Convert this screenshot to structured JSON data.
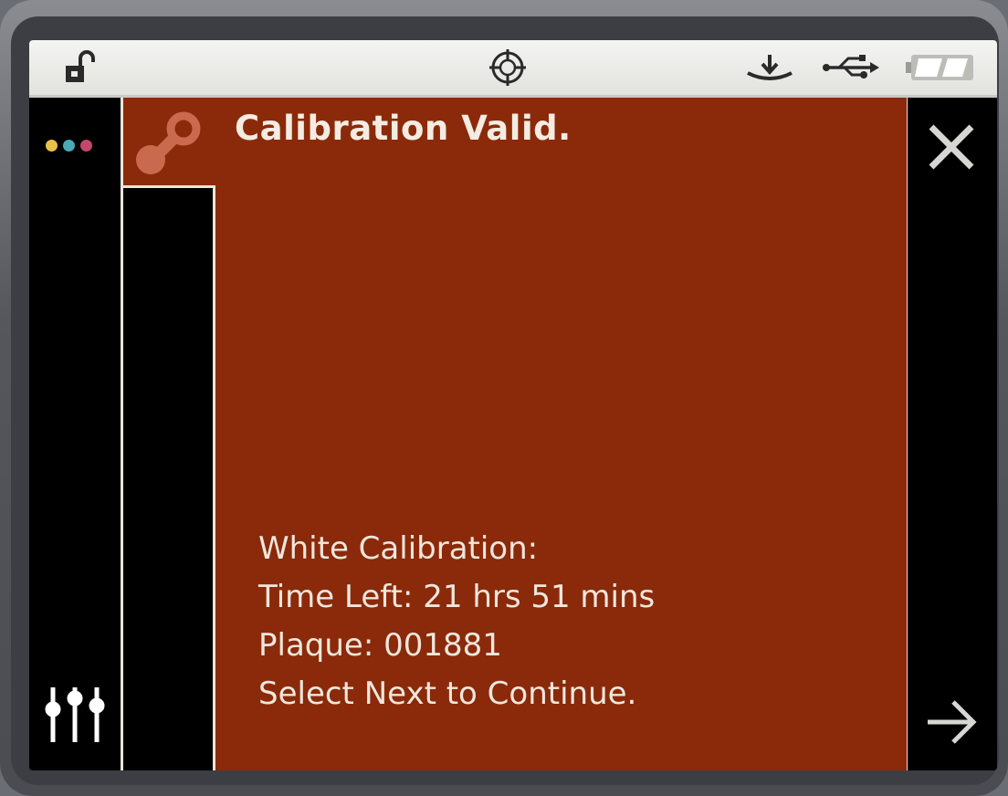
{
  "status_bar": {
    "lock_icon": "unlocked-padlock-icon",
    "center_icon": "crosshair-target-icon",
    "icons_right": [
      "download-tray-icon",
      "usb-icon",
      "battery-icon"
    ]
  },
  "left_rail": {
    "indicator_dots": [
      "#e8c04a",
      "#4aa8b8",
      "#c4486a"
    ],
    "settings_icon": "sliders-icon"
  },
  "dialog": {
    "icon": "calibration-plaque-icon",
    "title": "Calibration Valid.",
    "lines": {
      "heading": "White Calibration:",
      "time_left": "Time Left: 21 hrs 51 mins",
      "plaque": "Plaque: 001881",
      "instruction": "Select Next to Continue."
    }
  },
  "right_rail": {
    "close_icon": "close-icon",
    "next_icon": "arrow-right-icon"
  },
  "colors": {
    "panel_bg": "#8a2a0a",
    "text": "#f4ece2",
    "status_bar_bg": "#ecece8"
  }
}
